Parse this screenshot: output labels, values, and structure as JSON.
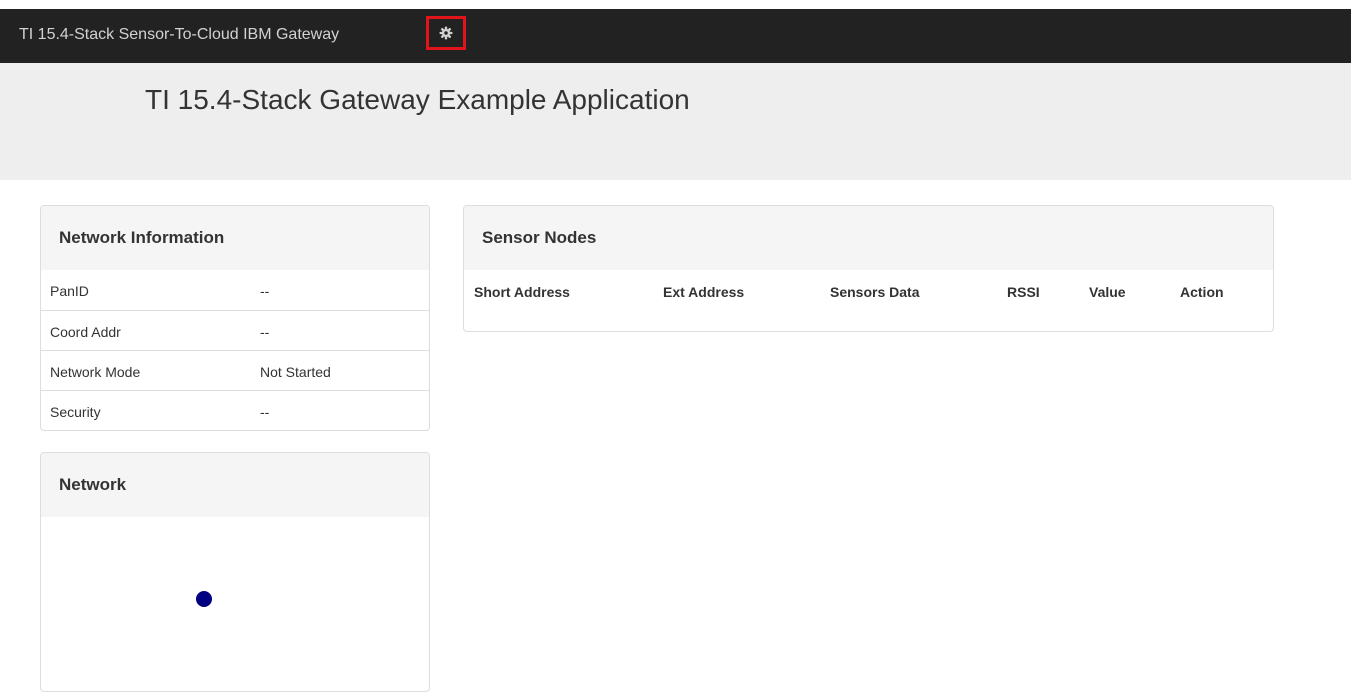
{
  "navbar": {
    "brand": "TI 15.4-Stack Sensor-To-Cloud IBM Gateway",
    "settings_icon": "gear-icon",
    "highlight_color": "#e0141a"
  },
  "header": {
    "title": "TI 15.4-Stack Gateway Example Application"
  },
  "network_info": {
    "title": "Network Information",
    "rows": [
      {
        "label": "PanID",
        "value": "--"
      },
      {
        "label": "Coord Addr",
        "value": "--"
      },
      {
        "label": "Network Mode",
        "value": "Not Started"
      },
      {
        "label": "Security",
        "value": "--"
      }
    ]
  },
  "sensor_nodes": {
    "title": "Sensor Nodes",
    "columns": [
      "Short Address",
      "Ext Address",
      "Sensors Data",
      "RSSI",
      "Value",
      "Action"
    ],
    "rows": []
  },
  "network": {
    "title": "Network",
    "node_color": "#000080"
  }
}
